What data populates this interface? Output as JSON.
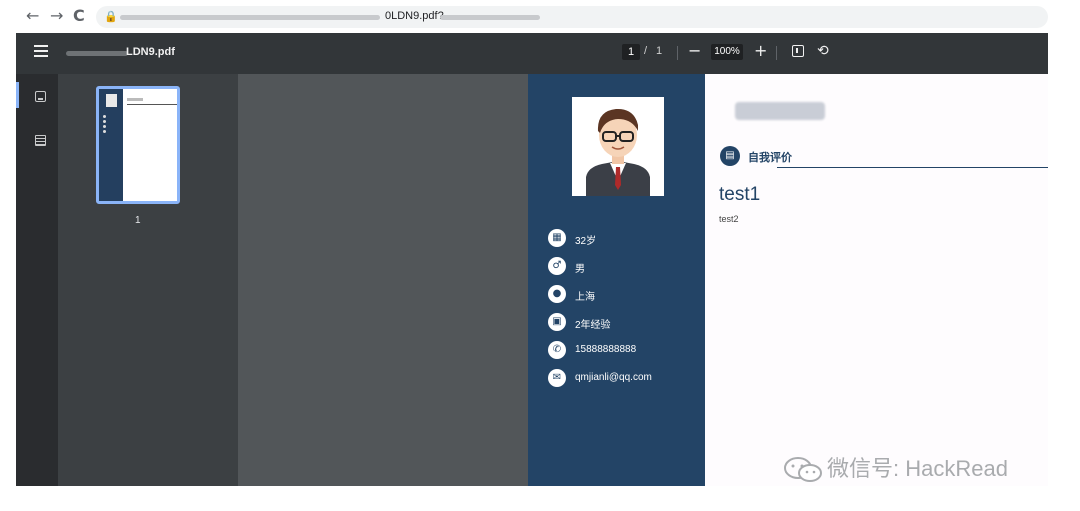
{
  "browser": {
    "back_icon": "arrow-left-icon",
    "forward_icon": "arrow-right-icon",
    "reload_icon": "reload-icon",
    "url_visible": "0LDN9.pdf?"
  },
  "toolbar": {
    "menu_icon": "hamburger-menu-icon",
    "file_name": "LDN9.pdf",
    "current_page": "1",
    "page_separator": "/",
    "total_pages": "1",
    "zoom_out_glyph": "−",
    "zoom_level": "100%",
    "zoom_in_glyph": "+",
    "fit_icon": "fit-page-icon",
    "rotate_icon": "rotate-icon"
  },
  "sidebar_rail": {
    "thumbnails_icon": "thumbnails-icon",
    "outline_icon": "document-outline-icon"
  },
  "thumbnail": {
    "page_number": "1"
  },
  "resume": {
    "info": [
      {
        "icon": "calendar-icon",
        "text": "32岁"
      },
      {
        "icon": "gender-male-icon",
        "text": "男"
      },
      {
        "icon": "location-pin-icon",
        "text": "上海"
      },
      {
        "icon": "briefcase-icon",
        "text": "2年经验"
      },
      {
        "icon": "phone-icon",
        "text": "15888888888"
      },
      {
        "icon": "mail-icon",
        "text": "qmjianli@qq.com"
      }
    ],
    "section_title": "自我评价",
    "heading": "test1",
    "body": "test2"
  },
  "watermark": {
    "text": "微信号: HackRead"
  },
  "colors": {
    "resume_navy": "#234466",
    "toolbar_bg": "#323639",
    "viewer_bg": "#525659",
    "thumb_pane_bg": "#3c4043",
    "accent_blue": "#8ab4f8"
  }
}
